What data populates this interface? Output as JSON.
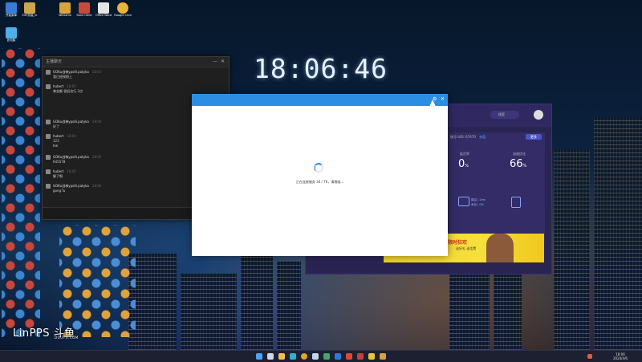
{
  "clock": {
    "time": "18:06:46"
  },
  "desktop_icons": [
    {
      "label": "开始菜单",
      "color": "#3a7bd5"
    },
    {
      "label": "EVE安装_in",
      "color": "#caa74a"
    },
    {
      "label": "WeGame",
      "color": "#d9a43a"
    },
    {
      "label": "Rust Client",
      "color": "#c84a3a"
    },
    {
      "label": "Office Word",
      "color": "#e6e6e6"
    },
    {
      "label": "此电脑",
      "color": "#4fb0e8"
    },
    {
      "label": "Google Chrome",
      "color": "#e8b53a"
    }
  ],
  "chat": {
    "title": "主播聊天",
    "messages": [
      {
        "name": "GOKu战神ypolli.patyka",
        "time": "18:01",
        "text": "我已经按照上"
      },
      {
        "name": "hubert",
        "time": "18:03",
        "text": "拿金额 很低也行 3点"
      },
      {
        "name": "GOKu战神ypolli.patyka",
        "time": "18:04",
        "text": "好了"
      },
      {
        "name": "hubert",
        "time": "18:04",
        "text": "123"
      },
      {
        "name": "GOKu战神ypolli.patyka",
        "time": "18:05",
        "text": "hm"
      },
      {
        "name": "GOKu战神ypolli.patyka",
        "time": "18:05",
        "text": "645578"
      },
      {
        "name": "hubert",
        "time": "18:05",
        "text": "解了啊"
      },
      {
        "name": "GOKu战神ypolli.patyka",
        "time": "18:06",
        "text": "gong fu"
      }
    ]
  },
  "app": {
    "search_placeholder": "搜索",
    "uid": "账号:UID: 67470",
    "recharge": "充值",
    "button": "更多",
    "stat1_label": "延迟率",
    "stat1_value": "0",
    "stat1_unit": "%",
    "stat2_label": "加速优化",
    "stat2_value": "66",
    "stat2_unit": "%",
    "router_label": "路由 | 2ms",
    "loss_label": "丢包 | 0%",
    "banner_title": "限时狂欢",
    "banner_sub": "送好礼 送话费"
  },
  "dialog": {
    "status": "正在连接服务 34 / 76，请稍候..."
  },
  "watermark": {
    "brand": "LinPPS 斗鱼",
    "sub": "DOUYU.COM"
  },
  "taskbar": {
    "icons": [
      {
        "name": "windows-start-icon",
        "color": "#4aa3ff"
      },
      {
        "name": "search-icon",
        "color": "#d0d6e6"
      },
      {
        "name": "file-explorer-icon",
        "color": "#f1c04a"
      },
      {
        "name": "edge-icon",
        "color": "#2fb3c9"
      },
      {
        "name": "chrome-icon",
        "color": "#e0a331"
      },
      {
        "name": "steam-icon",
        "color": "#c4d3e8"
      },
      {
        "name": "app-icon-1",
        "color": "#4aa36f"
      },
      {
        "name": "app-icon-2",
        "color": "#2c7bd9"
      },
      {
        "name": "app-icon-3",
        "color": "#d84a3a"
      },
      {
        "name": "app-icon-4",
        "color": "#c44040"
      },
      {
        "name": "app-icon-5",
        "color": "#e8c43a"
      },
      {
        "name": "app-icon-6",
        "color": "#d8a040"
      }
    ],
    "time": "18:06",
    "date": "2024/4/6"
  }
}
